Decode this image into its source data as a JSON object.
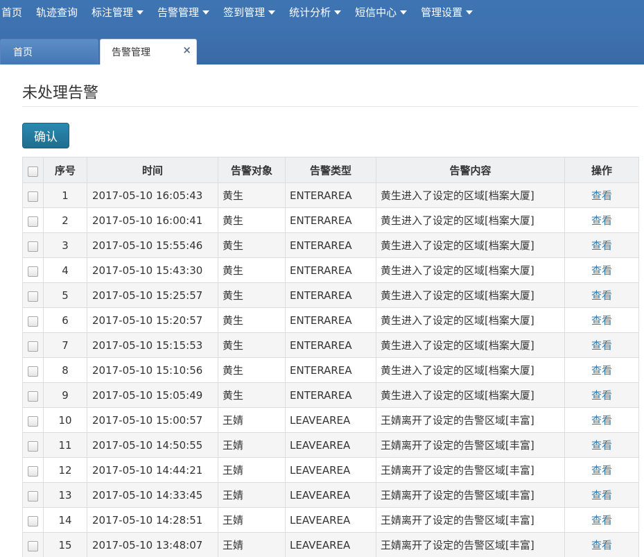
{
  "nav": {
    "items": [
      {
        "label": "首页",
        "dropdown": false
      },
      {
        "label": "轨迹查询",
        "dropdown": false
      },
      {
        "label": "标注管理",
        "dropdown": true
      },
      {
        "label": "告警管理",
        "dropdown": true
      },
      {
        "label": "签到管理",
        "dropdown": true
      },
      {
        "label": "统计分析",
        "dropdown": true
      },
      {
        "label": "短信中心",
        "dropdown": true
      },
      {
        "label": "管理设置",
        "dropdown": true
      }
    ]
  },
  "tabs": {
    "home_label": "首页",
    "active_label": "告警管理",
    "close_glyph": "×"
  },
  "page": {
    "title": "未处理告警",
    "confirm_label": "确认"
  },
  "table": {
    "headers": {
      "index": "序号",
      "time": "时间",
      "target": "告警对象",
      "type": "告警类型",
      "content": "告警内容",
      "action": "操作"
    },
    "rows": [
      {
        "index": "1",
        "time": "2017-05-10 16:05:43",
        "target": "黄生",
        "type": "ENTERAREA",
        "content": "黄生进入了设定的区域[档案大厦]",
        "action": "查看"
      },
      {
        "index": "2",
        "time": "2017-05-10 16:00:41",
        "target": "黄生",
        "type": "ENTERAREA",
        "content": "黄生进入了设定的区域[档案大厦]",
        "action": "查看"
      },
      {
        "index": "3",
        "time": "2017-05-10 15:55:46",
        "target": "黄生",
        "type": "ENTERAREA",
        "content": "黄生进入了设定的区域[档案大厦]",
        "action": "查看"
      },
      {
        "index": "4",
        "time": "2017-05-10 15:43:30",
        "target": "黄生",
        "type": "ENTERAREA",
        "content": "黄生进入了设定的区域[档案大厦]",
        "action": "查看"
      },
      {
        "index": "5",
        "time": "2017-05-10 15:25:57",
        "target": "黄生",
        "type": "ENTERAREA",
        "content": "黄生进入了设定的区域[档案大厦]",
        "action": "查看"
      },
      {
        "index": "6",
        "time": "2017-05-10 15:20:57",
        "target": "黄生",
        "type": "ENTERAREA",
        "content": "黄生进入了设定的区域[档案大厦]",
        "action": "查看"
      },
      {
        "index": "7",
        "time": "2017-05-10 15:15:53",
        "target": "黄生",
        "type": "ENTERAREA",
        "content": "黄生进入了设定的区域[档案大厦]",
        "action": "查看"
      },
      {
        "index": "8",
        "time": "2017-05-10 15:10:56",
        "target": "黄生",
        "type": "ENTERAREA",
        "content": "黄生进入了设定的区域[档案大厦]",
        "action": "查看"
      },
      {
        "index": "9",
        "time": "2017-05-10 15:05:49",
        "target": "黄生",
        "type": "ENTERAREA",
        "content": "黄生进入了设定的区域[档案大厦]",
        "action": "查看"
      },
      {
        "index": "10",
        "time": "2017-05-10 15:00:57",
        "target": "王婧",
        "type": "LEAVEAREA",
        "content": "王婧离开了设定的告警区域[丰富]",
        "action": "查看"
      },
      {
        "index": "11",
        "time": "2017-05-10 14:50:55",
        "target": "王婧",
        "type": "LEAVEAREA",
        "content": "王婧离开了设定的告警区域[丰富]",
        "action": "查看"
      },
      {
        "index": "12",
        "time": "2017-05-10 14:44:21",
        "target": "王婧",
        "type": "LEAVEAREA",
        "content": "王婧离开了设定的告警区域[丰富]",
        "action": "查看"
      },
      {
        "index": "13",
        "time": "2017-05-10 14:33:45",
        "target": "王婧",
        "type": "LEAVEAREA",
        "content": "王婧离开了设定的告警区域[丰富]",
        "action": "查看"
      },
      {
        "index": "14",
        "time": "2017-05-10 14:28:51",
        "target": "王婧",
        "type": "LEAVEAREA",
        "content": "王婧离开了设定的告警区域[丰富]",
        "action": "查看"
      },
      {
        "index": "15",
        "time": "2017-05-10 13:48:07",
        "target": "王婧",
        "type": "LEAVEAREA",
        "content": "王婧离开了设定的告警区域[丰富]",
        "action": "查看"
      }
    ]
  }
}
